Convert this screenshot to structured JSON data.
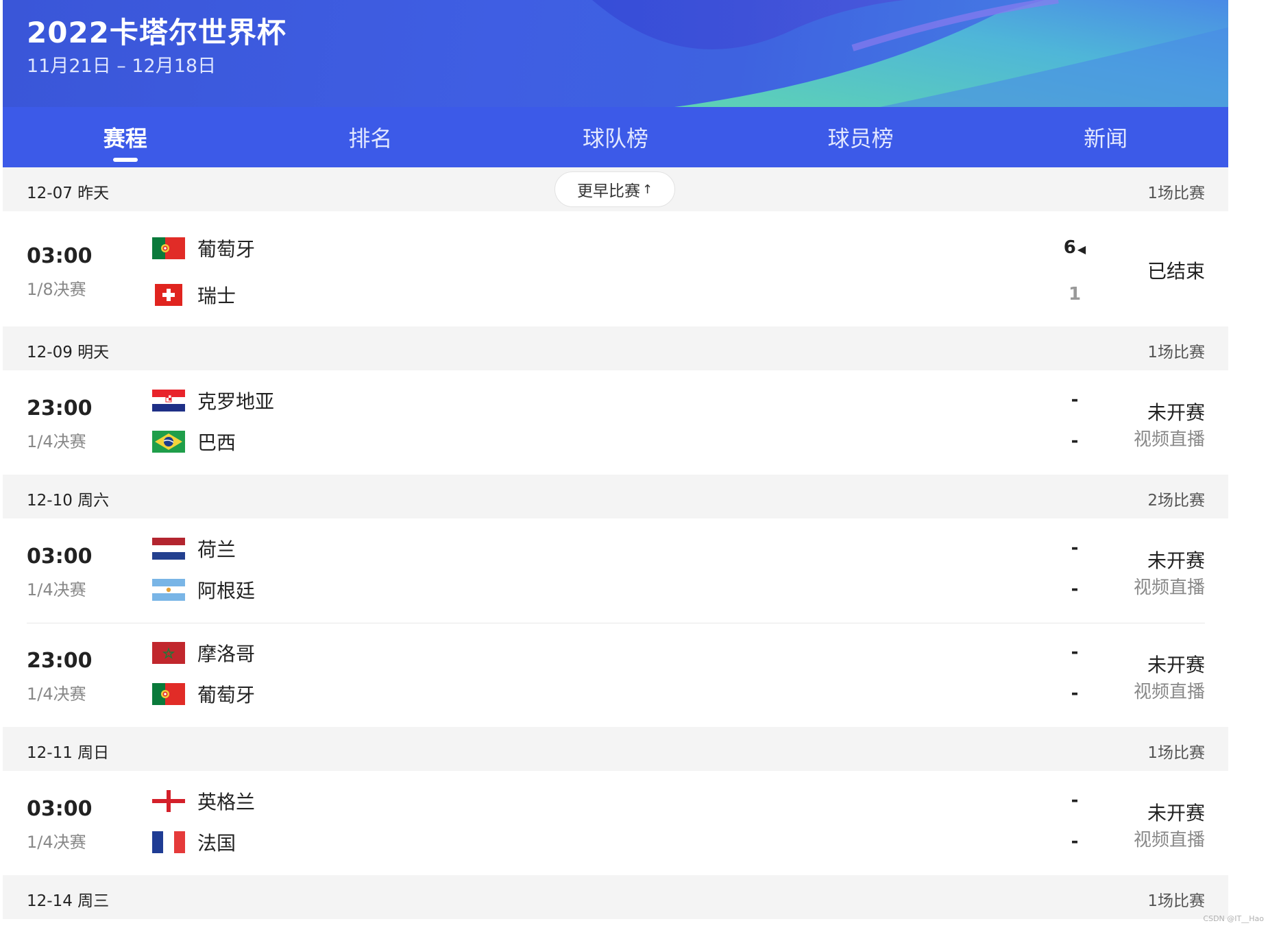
{
  "header": {
    "title": "2022卡塔尔世界杯",
    "dates": "11月21日 – 12月18日"
  },
  "tabs": [
    "赛程",
    "排名",
    "球队榜",
    "球员榜",
    "新闻"
  ],
  "earlier_button": {
    "label": "更早比赛",
    "arrow": "↑"
  },
  "days": [
    {
      "label": "12-07 昨天",
      "count": "1场比赛",
      "matches": [
        {
          "time": "03:00",
          "stage": "1/8决赛",
          "home": {
            "name": "葡萄牙",
            "flag": "portugal-flag",
            "score": "6",
            "winner_mark": "◀"
          },
          "away": {
            "name": "瑞士",
            "flag": "switzerland-flag",
            "score": "1"
          },
          "status": "已结束",
          "live": ""
        }
      ]
    },
    {
      "label": "12-09 明天",
      "count": "1场比赛",
      "matches": [
        {
          "time": "23:00",
          "stage": "1/4决赛",
          "home": {
            "name": "克罗地亚",
            "flag": "croatia-flag",
            "score": "-"
          },
          "away": {
            "name": "巴西",
            "flag": "brazil-flag",
            "score": "-"
          },
          "status": "未开赛",
          "live": "视频直播"
        }
      ]
    },
    {
      "label": "12-10 周六",
      "count": "2场比赛",
      "matches": [
        {
          "time": "03:00",
          "stage": "1/4决赛",
          "home": {
            "name": "荷兰",
            "flag": "netherlands-flag",
            "score": "-"
          },
          "away": {
            "name": "阿根廷",
            "flag": "argentina-flag",
            "score": "-"
          },
          "status": "未开赛",
          "live": "视频直播"
        },
        {
          "time": "23:00",
          "stage": "1/4决赛",
          "home": {
            "name": "摩洛哥",
            "flag": "morocco-flag",
            "score": "-"
          },
          "away": {
            "name": "葡萄牙",
            "flag": "portugal-flag",
            "score": "-"
          },
          "status": "未开赛",
          "live": "视频直播"
        }
      ]
    },
    {
      "label": "12-11 周日",
      "count": "1场比赛",
      "matches": [
        {
          "time": "03:00",
          "stage": "1/4决赛",
          "home": {
            "name": "英格兰",
            "flag": "england-flag",
            "score": "-"
          },
          "away": {
            "name": "法国",
            "flag": "france-flag",
            "score": "-"
          },
          "status": "未开赛",
          "live": "视频直播"
        }
      ]
    },
    {
      "label": "12-14 周三",
      "count": "1场比赛",
      "matches": []
    }
  ],
  "watermark": "CSDN @IT__Hao",
  "colors": {
    "brand_blue": "#3c5ae8",
    "accent_green": "#5ed3b4",
    "day_header_bg": "#f4f4f4"
  }
}
